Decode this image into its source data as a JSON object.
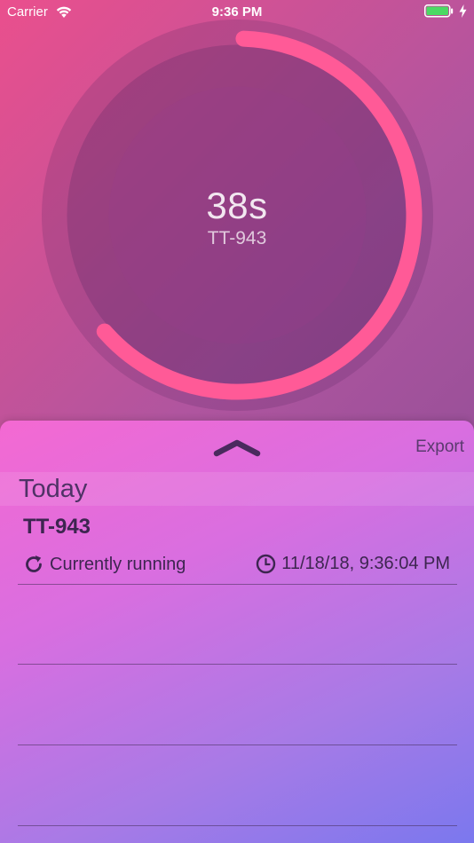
{
  "status_bar": {
    "carrier": "Carrier",
    "time": "9:36 PM",
    "icons": [
      "wifi-icon",
      "battery-icon",
      "charging-bolt-icon"
    ]
  },
  "timer": {
    "elapsed": "38s",
    "task_id": "TT-943",
    "progress_fraction": 0.63,
    "ring_color": "#ff5a97"
  },
  "panel": {
    "chevron_icon": "chevron-up-icon",
    "export_label": "Export",
    "section_title": "Today",
    "entries": [
      {
        "title": "TT-943",
        "status": "Currently running",
        "status_icon": "refresh-icon",
        "timestamp": "11/18/18, 9:36:04 PM",
        "timestamp_icon": "clock-icon"
      }
    ]
  },
  "colors": {
    "background_start": "#ea4f8d",
    "background_end": "#7d4a92",
    "panel_start": "#f469d2",
    "panel_end": "#7b78ee",
    "text_dark": "#3d2550"
  }
}
